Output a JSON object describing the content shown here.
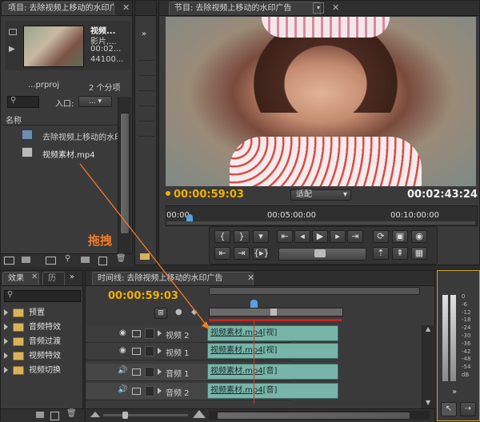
{
  "project": {
    "tab": "项目: 去除视频上移动的水印广告",
    "clip_name": "视频...",
    "clip_type": "影片,...",
    "clip_tc": "00:02...",
    "clip_rate": "44100...",
    "proj_file": "...prproj",
    "item_count": "2 个分项",
    "entry_label": "入口:",
    "entry_value": "...",
    "col_name": "名称",
    "items": [
      {
        "label": "去除视频上移动的水印广告"
      },
      {
        "label": "视频素材.mp4"
      }
    ]
  },
  "annotation": {
    "drag_label": "拖拽"
  },
  "monitor": {
    "tab": "节目: 去除视频上移动的水印广告",
    "current_tc": "00:00:59:03",
    "fit_label": "适配",
    "duration_tc": "00:02:43:24",
    "ruler": [
      "00:00",
      "00:05:00:00",
      "00:10:00:00"
    ]
  },
  "effects": {
    "tab_effects": "效果",
    "tab_history": "历",
    "items": [
      {
        "label": "预置"
      },
      {
        "label": "音频特效"
      },
      {
        "label": "音频过渡"
      },
      {
        "label": "视频特效"
      },
      {
        "label": "视频切换"
      }
    ]
  },
  "timeline": {
    "tab": "时间线: 去除视频上移动的水印广告",
    "current_tc": "00:00:59:03",
    "tracks": [
      {
        "name": "视频 2",
        "clip_name": "视频素材",
        "clip_ext": ".mp4",
        "clip_tag": "[视]"
      },
      {
        "name": "视频 1",
        "clip_name": "视频素材",
        "clip_ext": ".mp4",
        "clip_tag": "[视]"
      },
      {
        "name": "音频 1",
        "clip_name": "视频素材",
        "clip_ext": ".mp4",
        "clip_tag": "[音]"
      },
      {
        "name": "音频 2",
        "clip_name": "视频素材",
        "clip_ext": ".mp4",
        "clip_tag": "[音]"
      }
    ]
  },
  "meter": {
    "labels": [
      "0",
      "-6",
      "-12",
      "-18",
      "-24",
      "-30",
      "-36",
      "-42",
      "-48",
      "-54",
      "dB"
    ]
  },
  "colors": {
    "timecode": "#f0b000",
    "clip": "#77b5a8",
    "arrow": "#f07a2a",
    "workbar": "#d02020"
  }
}
